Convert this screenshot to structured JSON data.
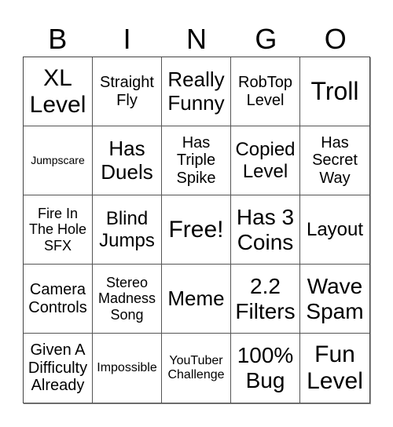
{
  "header": [
    "B",
    "I",
    "N",
    "G",
    "O"
  ],
  "cells": [
    "XL Level",
    "Straight Fly",
    "Really Funny",
    "RobTop Level",
    "Troll",
    "Jumpscare",
    "Has Duels",
    "Has Triple Spike",
    "Copied Level",
    "Has Secret Way",
    "Fire In The Hole SFX",
    "Blind Jumps",
    "Free!",
    "Has 3 Coins",
    "Layout",
    "Camera Controls",
    "Stereo Madness Song",
    "Meme",
    "2.2 Filters",
    "Wave Spam",
    "Given A Difficulty Already",
    "Impossible",
    "YouTuber Challenge",
    "100% Bug",
    "Fun Level"
  ]
}
